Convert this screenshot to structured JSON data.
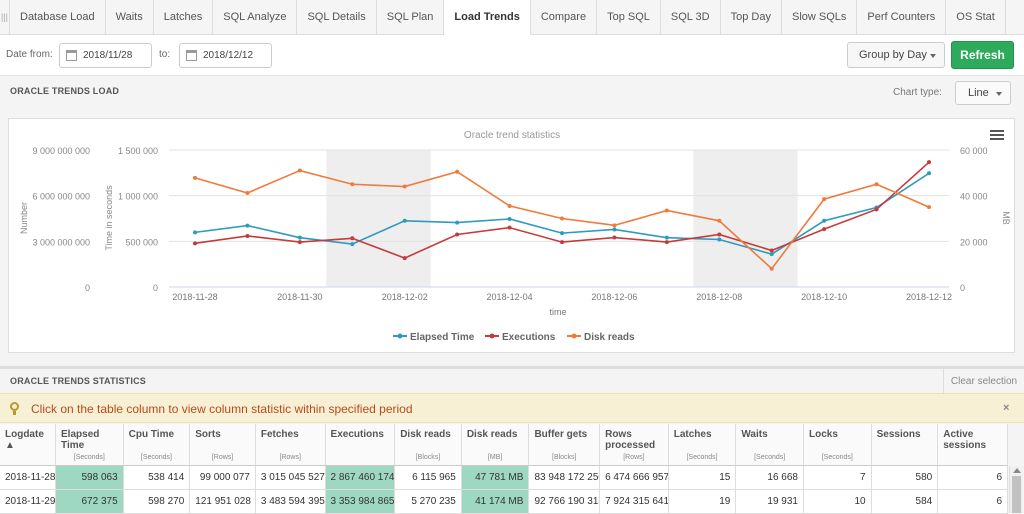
{
  "tabs": [
    {
      "label": "Database Load"
    },
    {
      "label": "Waits"
    },
    {
      "label": "Latches"
    },
    {
      "label": "SQL Analyze"
    },
    {
      "label": "SQL Details"
    },
    {
      "label": "SQL Plan"
    },
    {
      "label": "Load Trends",
      "active": true
    },
    {
      "label": "Compare"
    },
    {
      "label": "Top SQL"
    },
    {
      "label": "SQL 3D"
    },
    {
      "label": "Top Day"
    },
    {
      "label": "Slow SQLs"
    },
    {
      "label": "Perf Counters"
    },
    {
      "label": "OS Stat"
    }
  ],
  "toolbar": {
    "date_from_label": "Date from:",
    "date_from": "2018/11/28",
    "to_label": "to:",
    "date_to": "2018/12/12",
    "group_by": "Group by Day",
    "refresh": "Refresh"
  },
  "load_section": {
    "title": "ORACLE TRENDS LOAD",
    "chart_type_label": "Chart type:",
    "chart_type": "Line"
  },
  "chart_data": {
    "type": "line",
    "title": "Oracle trend statistics",
    "xlabel": "time",
    "x": [
      "2018-11-28",
      "2018-11-29",
      "2018-11-30",
      "2018-12-01",
      "2018-12-02",
      "2018-12-03",
      "2018-12-04",
      "2018-12-05",
      "2018-12-06",
      "2018-12-07",
      "2018-12-08",
      "2018-12-09",
      "2018-12-10",
      "2018-12-11",
      "2018-12-12"
    ],
    "x_tick_labels": [
      "2018-11-28",
      "2018-11-30",
      "2018-12-02",
      "2018-12-04",
      "2018-12-06",
      "2018-12-08",
      "2018-12-10",
      "2018-12-12"
    ],
    "axes": [
      {
        "id": "number",
        "label": "Number",
        "ticks": [
          "9 000 000 000",
          "6 000 000 000",
          "3 000 000 000",
          "0"
        ],
        "range": [
          0,
          9000000000
        ]
      },
      {
        "id": "time",
        "label": "Time in seconds",
        "ticks": [
          "1 500 000",
          "1 000 000",
          "500 000",
          "0"
        ],
        "range": [
          0,
          1500000
        ]
      },
      {
        "id": "mb",
        "label": "MB",
        "ticks": [
          "60 000",
          "40 000",
          "20 000",
          "0"
        ],
        "range": [
          0,
          60000
        ]
      }
    ],
    "series": [
      {
        "name": "Elapsed Time",
        "color": "#2b9bbf",
        "axis": "time",
        "values": [
          598063,
          672375,
          540000,
          470000,
          725000,
          705000,
          745000,
          590000,
          630000,
          540000,
          520000,
          360000,
          725000,
          870000,
          1245000
        ]
      },
      {
        "name": "Executions",
        "color": "#c83a3a",
        "axis": "number",
        "values": [
          2867460174,
          3353984865,
          2950000000,
          3200000000,
          1900000000,
          3450000000,
          3900000000,
          2950000000,
          3250000000,
          2950000000,
          3450000000,
          2400000000,
          3800000000,
          5100000000,
          8200000000
        ]
      },
      {
        "name": "Disk reads",
        "color": "#f07a3a",
        "axis": "mb",
        "values": [
          47781,
          41174,
          51000,
          45000,
          44000,
          50500,
          35500,
          30000,
          27000,
          33500,
          29000,
          8000,
          38500,
          45000,
          35000
        ]
      }
    ],
    "shaded_periods": [
      [
        "2018-12-01",
        "2018-12-02"
      ],
      [
        "2018-12-08",
        "2018-12-09"
      ]
    ],
    "grid": true,
    "legend_position": "bottom-center"
  },
  "stats_section": {
    "title": "ORACLE TRENDS STATISTICS",
    "clear_selection": "Clear selection",
    "hint": "Click on the table column to view column statistic within specified period",
    "hint_close": "×"
  },
  "table": {
    "columns": [
      {
        "label": "Logdate ▲",
        "unit": ""
      },
      {
        "label": "Elapsed Time",
        "unit": "[Seconds]"
      },
      {
        "label": "Cpu Time",
        "unit": "[Seconds]"
      },
      {
        "label": "Sorts",
        "unit": "[Rows]"
      },
      {
        "label": "Fetches",
        "unit": "[Rows]"
      },
      {
        "label": "Executions",
        "unit": ""
      },
      {
        "label": "Disk reads",
        "unit": "[Blocks]"
      },
      {
        "label": "Disk reads",
        "unit": "[MB]"
      },
      {
        "label": "Buffer gets",
        "unit": "[Blocks]"
      },
      {
        "label": "Rows processed",
        "unit": "[Rows]"
      },
      {
        "label": "Latches",
        "unit": "[Seconds]"
      },
      {
        "label": "Waits",
        "unit": "[Seconds]"
      },
      {
        "label": "Locks",
        "unit": "[Seconds]"
      },
      {
        "label": "Sessions",
        "unit": ""
      },
      {
        "label": "Active sessions",
        "unit": ""
      }
    ],
    "rows": [
      [
        "2018-11-28",
        "598 063",
        "538 414",
        "99 000 077",
        "3 015 045 527",
        "2 867 460 174",
        "6 115 965",
        "47 781 MB",
        "83 948 172 250",
        "6 474 666 957",
        "15",
        "16 668",
        "7",
        "580",
        "6"
      ],
      [
        "2018-11-29",
        "672 375",
        "598 270",
        "121 951 028",
        "3 483 594 395",
        "3 353 984 865",
        "5 270 235",
        "41 174 MB",
        "92 766 190 318",
        "7 924 315 641",
        "19",
        "19 931",
        "10",
        "584",
        "6"
      ]
    ]
  }
}
